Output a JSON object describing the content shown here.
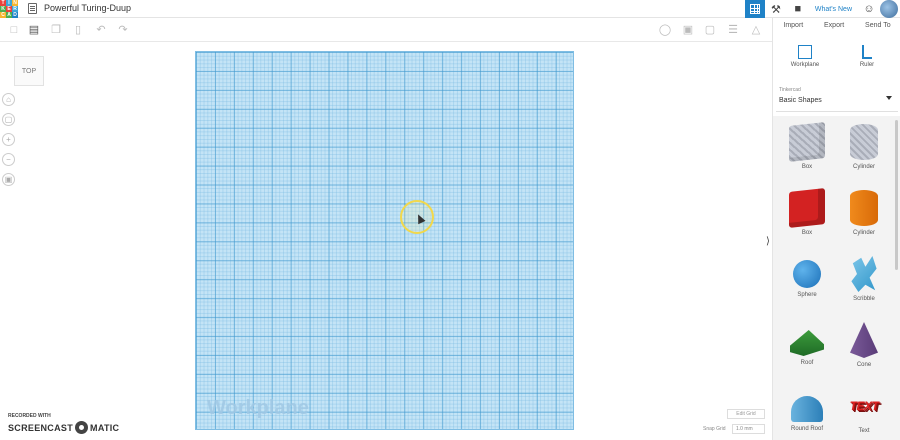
{
  "app": {
    "logo_letters": [
      "T",
      "I",
      "N",
      "K",
      "E",
      "R",
      "C",
      "A",
      "D"
    ],
    "logo_colors": [
      "#e8413c",
      "#3aa5d8",
      "#f5b52e",
      "#4caf50",
      "#e8413c",
      "#3aa5d8",
      "#f5b52e",
      "#4caf50",
      "#1f82c7"
    ],
    "design_title": "Powerful Turing-Duup",
    "whats_new": "What's New"
  },
  "view": {
    "viewcube_label": "TOP"
  },
  "workplane": {
    "label": "Workplane",
    "edit_grid_label": "Edit Grid",
    "snap_grid_label": "Snap Grid",
    "snap_grid_value": "1.0 mm"
  },
  "panel": {
    "tabs": [
      "Import",
      "Export",
      "Send To"
    ],
    "workplane_tool": "Workplane",
    "ruler_tool": "Ruler",
    "library_caption": "Tinkercad",
    "library_value": "Basic Shapes",
    "shapes": [
      {
        "label": "Box",
        "kind": "box-gray"
      },
      {
        "label": "Cylinder",
        "kind": "cyl-gray"
      },
      {
        "label": "Box",
        "kind": "box-red"
      },
      {
        "label": "Cylinder",
        "kind": "cyl-orange"
      },
      {
        "label": "Sphere",
        "kind": "sphere"
      },
      {
        "label": "Scribble",
        "kind": "scribble"
      },
      {
        "label": "Roof",
        "kind": "roof"
      },
      {
        "label": "Cone",
        "kind": "cone"
      },
      {
        "label": "Round Roof",
        "kind": "round-roof"
      },
      {
        "label": "Text",
        "kind": "text3d"
      }
    ],
    "text_shape_glyph": "TEXT"
  },
  "watermark": {
    "recorded_with": "RECORDED WITH",
    "left": "SCREENCAST",
    "right": "MATIC"
  }
}
